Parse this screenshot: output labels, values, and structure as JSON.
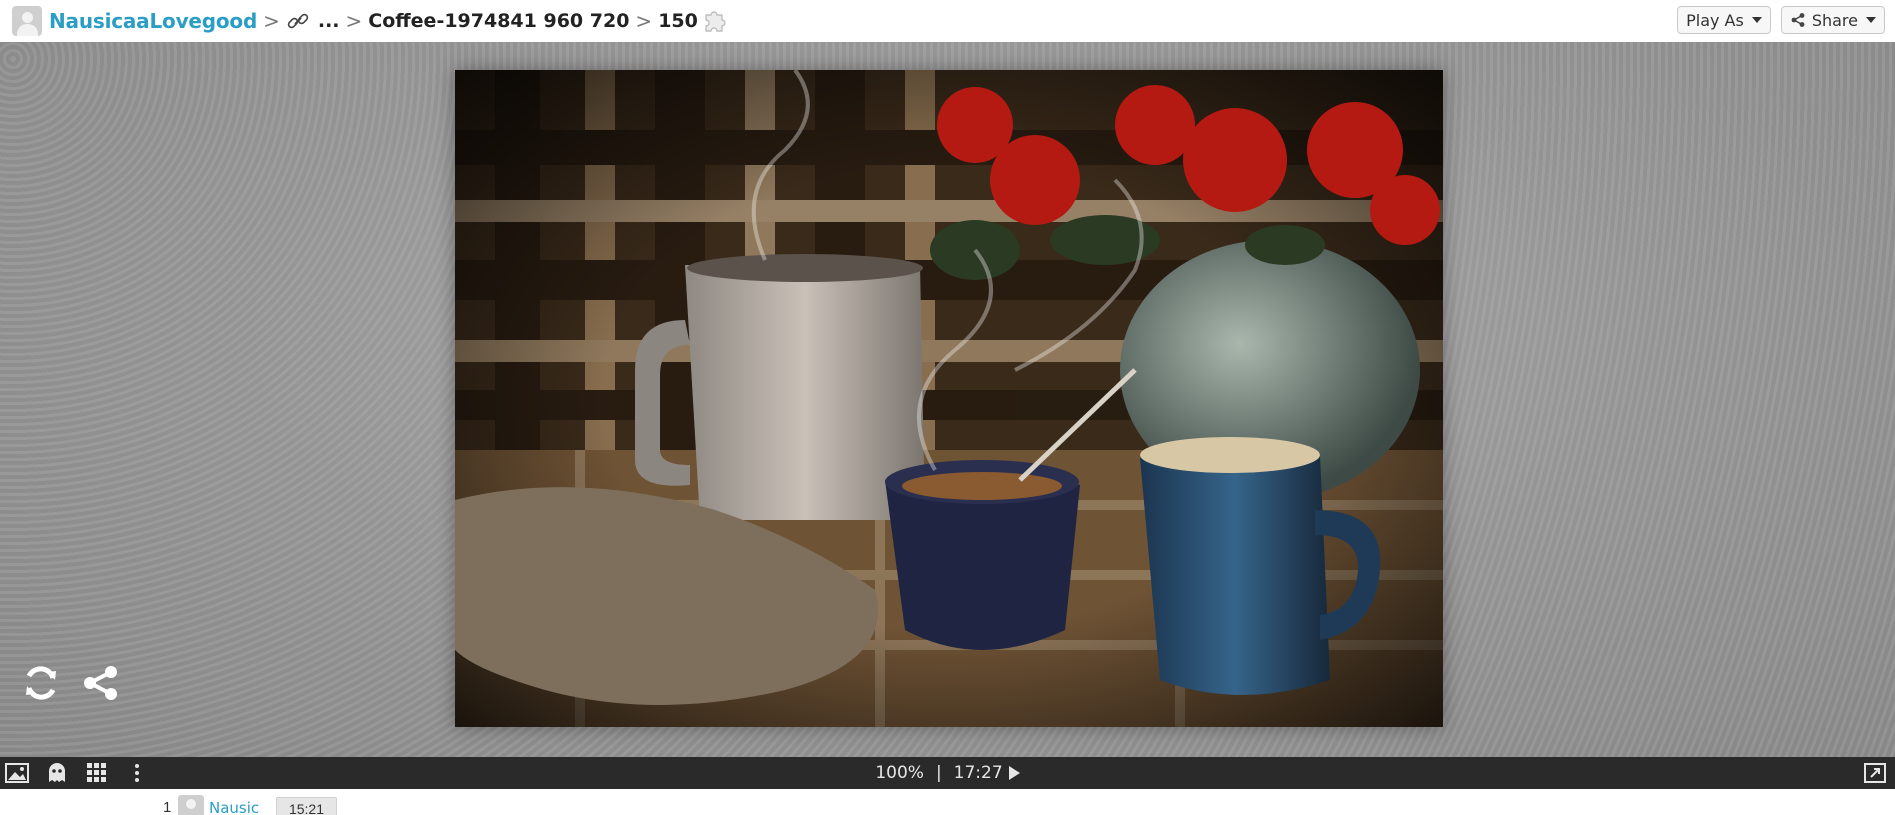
{
  "header": {
    "user_name": "NausicaaLovegood",
    "sep": ">",
    "ellipsis": "...",
    "puzzle_title": "Coffee-1974841 960 720",
    "piece_count": "150",
    "play_as_label": "Play As",
    "share_label": "Share"
  },
  "photo": {
    "subject": "Coffee mug, cup with spoon, blue creamer, knitted mitten and red flowers on plaid background"
  },
  "side_icons": [
    "refresh-icon",
    "share-icon"
  ],
  "statusbar": {
    "zoom": "100%",
    "divider": "|",
    "timer": "17:27",
    "left_icons": [
      "image-icon",
      "ghost-icon",
      "grid-icon",
      "more-icon"
    ],
    "right_icon": "fullscreen-icon"
  },
  "leaderboard": [
    {
      "rank": "1",
      "name": "Nausic",
      "time": "15:21"
    }
  ],
  "colors": {
    "accent": "#2a9ec4",
    "bar": "#2a2a2a"
  }
}
